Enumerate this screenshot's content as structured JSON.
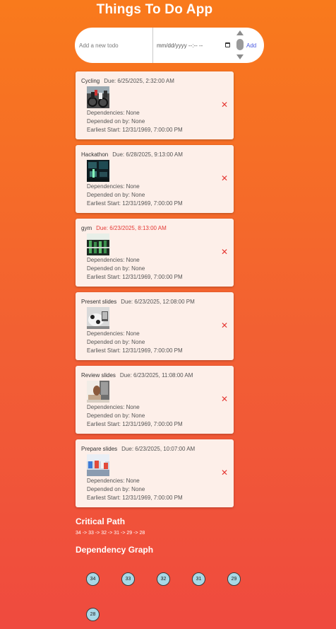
{
  "app": {
    "title": "Things To Do App"
  },
  "add_form": {
    "todo_placeholder": "Add a new todo",
    "date_placeholder": "mm/dd/yyyy --:-- --",
    "add_label": "Add"
  },
  "todos": [
    {
      "name": "Cycling",
      "due": "Due: 6/25/2025, 2:32:00 AM",
      "overdue": false,
      "image": "cycling-photo",
      "dependencies": "Dependencies: None",
      "depended_on_by": "Depended on by: None",
      "earliest_start": "Earliest Start: 12/31/1969, 7:00:00 PM",
      "delete_label": "✕"
    },
    {
      "name": "Hackathon",
      "due": "Due: 6/28/2025, 9:13:00 AM",
      "overdue": false,
      "image": "hackathon-photo",
      "dependencies": "Dependencies: None",
      "depended_on_by": "Depended on by: None",
      "earliest_start": "Earliest Start: 12/31/1969, 7:00:00 PM",
      "delete_label": "✕"
    },
    {
      "name": "gym",
      "due": "Due: 6/23/2025, 8:13:00 AM",
      "overdue": true,
      "image": "gym-photo",
      "dependencies": "Dependencies: None",
      "depended_on_by": "Depended on by: None",
      "earliest_start": "Earliest Start: 12/31/1969, 7:00:00 PM",
      "delete_label": "✕"
    },
    {
      "name": "Present slides",
      "due": "Due: 6/23/2025, 12:08:00 PM",
      "overdue": false,
      "image": "presentation-photo",
      "dependencies": "Dependencies: None",
      "depended_on_by": "Depended on by: None",
      "earliest_start": "Earliest Start: 12/31/1969, 7:00:00 PM",
      "delete_label": "✕"
    },
    {
      "name": "Review slides",
      "due": "Due: 6/23/2025, 11:08:00 AM",
      "overdue": false,
      "image": "review-photo",
      "dependencies": "Dependencies: None",
      "depended_on_by": "Depended on by: None",
      "earliest_start": "Earliest Start: 12/31/1969, 7:00:00 PM",
      "delete_label": "✕"
    },
    {
      "name": "Prepare slides",
      "due": "Due: 6/23/2025, 10:07:00 AM",
      "overdue": false,
      "image": "prepare-photo",
      "dependencies": "Dependencies: None",
      "depended_on_by": "Depended on by: None",
      "earliest_start": "Earliest Start: 12/31/1969, 7:00:00 PM",
      "delete_label": "✕"
    }
  ],
  "critical_path": {
    "title": "Critical Path",
    "path": "34 -> 33 -> 32 -> 31 -> 29 -> 28"
  },
  "dependency_graph": {
    "title": "Dependency Graph",
    "nodes": [
      "34",
      "33",
      "32",
      "31",
      "29",
      "28"
    ]
  },
  "colors": {
    "background_top": "#f97a1c",
    "background_bottom": "#ef4a3f",
    "card": "#fdefe9",
    "overdue": "#e53935",
    "delete": "#e53935",
    "add_link": "#4a5ae0",
    "graph_node": "#a8d8e6"
  }
}
